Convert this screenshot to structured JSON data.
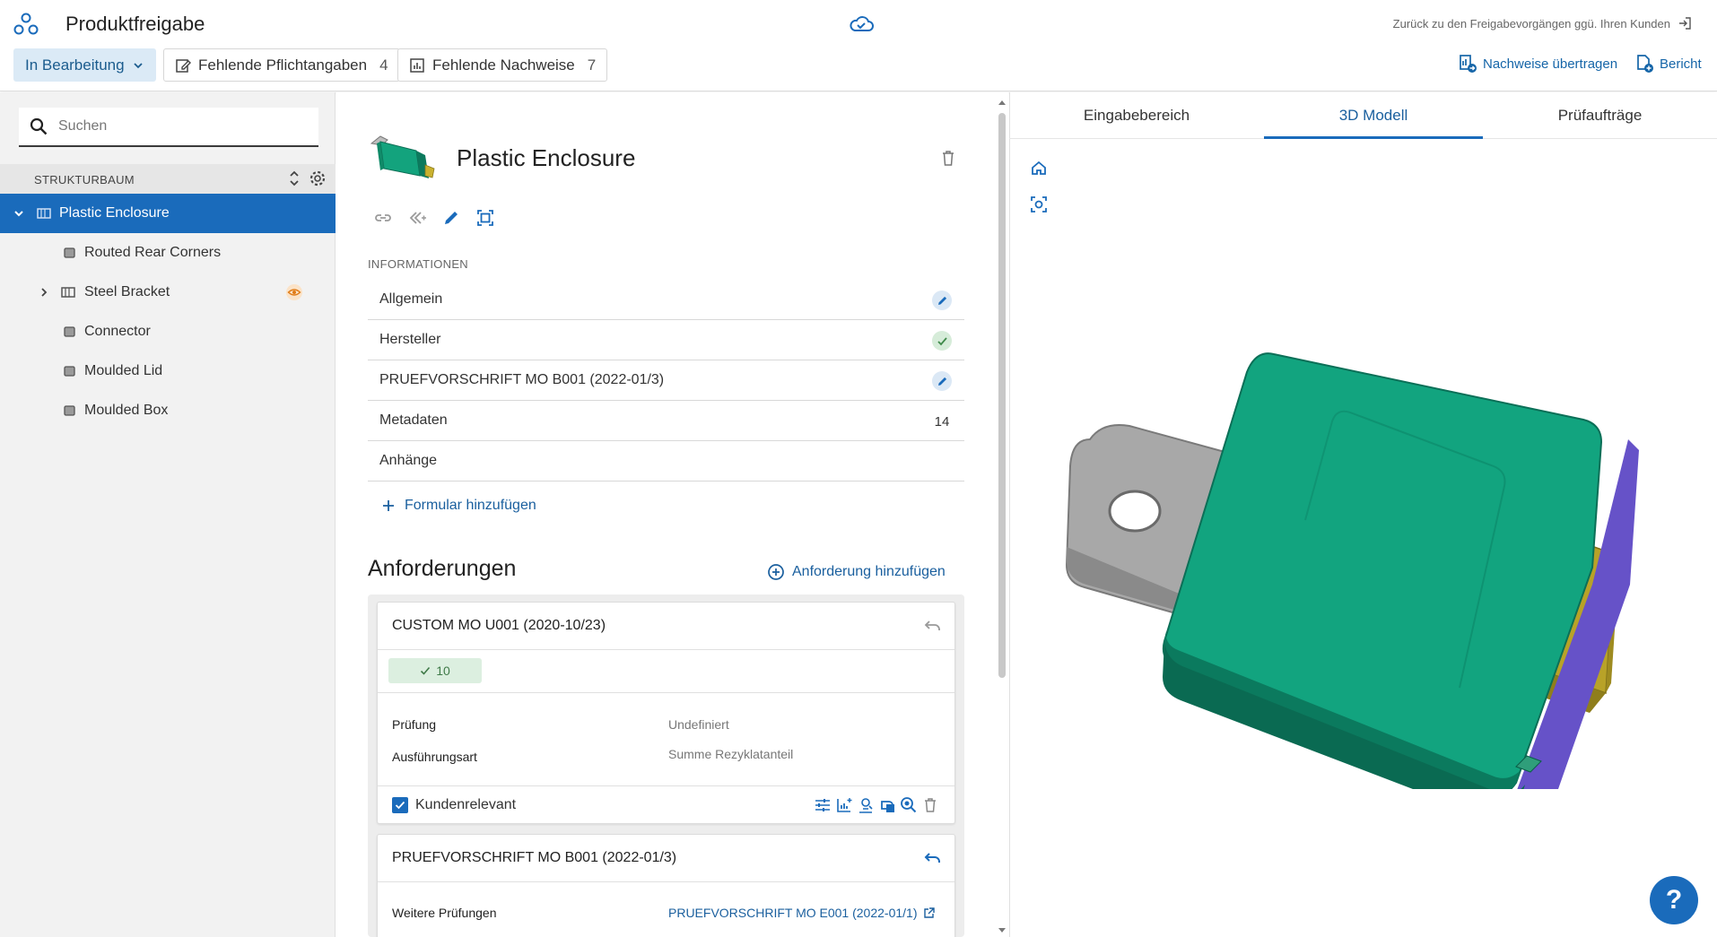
{
  "header": {
    "app_title": "Produktfreigabe",
    "back_link": "Zurück zu den Freigabevorgängen ggü. Ihren Kunden",
    "status": "In Bearbeitung",
    "missing_required": {
      "label": "Fehlende Pflichtangaben",
      "count": "4"
    },
    "missing_evidence": {
      "label": "Fehlende Nachweise",
      "count": "7"
    },
    "transfer_evidence": "Nachweise übertragen",
    "report": "Bericht"
  },
  "sidebar": {
    "search_placeholder": "Suchen",
    "tree_title": "STRUKTURBAUM",
    "items": [
      {
        "label": "Plastic Enclosure"
      },
      {
        "label": "Routed Rear Corners"
      },
      {
        "label": "Steel Bracket"
      },
      {
        "label": "Connector"
      },
      {
        "label": "Moulded Lid"
      },
      {
        "label": "Moulded Box"
      }
    ]
  },
  "detail": {
    "part_title": "Plastic Enclosure",
    "info_label": "INFORMATIONEN",
    "info_rows": [
      {
        "label": "Allgemein"
      },
      {
        "label": "Hersteller"
      },
      {
        "label": "PRUEFVORSCHRIFT MO B001 (2022-01/3)"
      },
      {
        "label": "Metadaten",
        "value": "14"
      },
      {
        "label": "Anhänge"
      }
    ],
    "add_form": "Formular hinzufügen",
    "requirements_title": "Anforderungen",
    "add_requirement": "Anforderung hinzufügen",
    "req1": {
      "title": "CUSTOM MO U001 (2020-10/23)",
      "passed_count": "10",
      "rows": [
        {
          "key": "Prüfung",
          "value": "Undefiniert"
        },
        {
          "key": "Ausführungsart",
          "value": "Summe Rezyklatanteil"
        }
      ],
      "customer_relevant": "Kundenrelevant"
    },
    "req2": {
      "title": "PRUEFVORSCHRIFT MO B001 (2022-01/3)",
      "rows": [
        {
          "key": "Weitere Prüfungen",
          "value": "PRUEFVORSCHRIFT MO E001 (2022-01/1)"
        }
      ]
    }
  },
  "viewer": {
    "tabs": [
      "Eingabebereich",
      "3D Modell",
      "Prüfaufträge"
    ],
    "active_tab": "3D Modell"
  },
  "help_label": "?",
  "colors": {
    "accent": "#1a6bbb",
    "link": "#1a5f9e",
    "model_body": "#12a47f",
    "model_edge": "#6652c8",
    "model_bracket": "#a8a8a8",
    "model_connector": "#b8a228"
  }
}
